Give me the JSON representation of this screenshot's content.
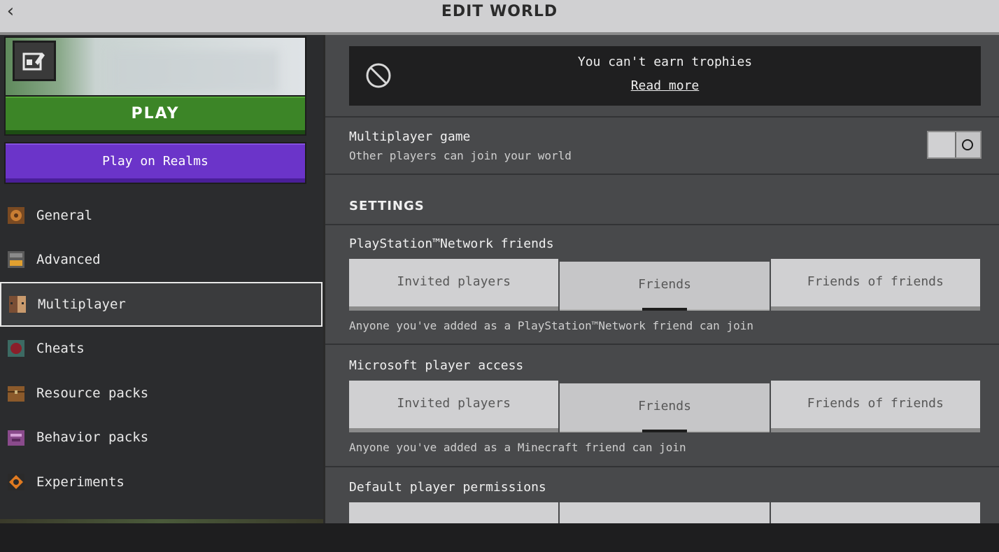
{
  "header": {
    "title": "EDIT WORLD",
    "back_icon": "chevron-left-icon"
  },
  "left": {
    "play_label": "PLAY",
    "realms_label": "Play on Realms",
    "nav": [
      {
        "label": "General",
        "icon": "gear-icon",
        "active": false
      },
      {
        "label": "Advanced",
        "icon": "furnace-icon",
        "active": false
      },
      {
        "label": "Multiplayer",
        "icon": "player-heads-icon",
        "active": true
      },
      {
        "label": "Cheats",
        "icon": "command-block-icon",
        "active": false
      },
      {
        "label": "Resource packs",
        "icon": "chest-icon",
        "active": false
      },
      {
        "label": "Behavior packs",
        "icon": "behavior-pack-icon",
        "active": false
      },
      {
        "label": "Experiments",
        "icon": "experiments-icon",
        "active": false
      }
    ]
  },
  "main": {
    "trophy": {
      "text": "You can't earn trophies",
      "link": "Read more"
    },
    "multiplayer": {
      "title": "Multiplayer game",
      "subtitle": "Other players can join your world",
      "enabled": false
    },
    "settings_title": "SETTINGS",
    "psn": {
      "title": "PlayStation™Network friends",
      "options": [
        "Invited players",
        "Friends",
        "Friends of friends"
      ],
      "selected": "Friends",
      "note": "Anyone you've added as a PlayStation™Network friend can join"
    },
    "microsoft": {
      "title": "Microsoft player access",
      "options": [
        "Invited players",
        "Friends",
        "Friends of friends"
      ],
      "selected": "Friends",
      "note": "Anyone you've added as a Minecraft friend can join"
    },
    "permissions": {
      "title": "Default player permissions"
    }
  },
  "colors": {
    "play": "#3c8527",
    "realms": "#6b34c9",
    "panel": "#48494b",
    "sidebar": "#2b2c2e"
  }
}
